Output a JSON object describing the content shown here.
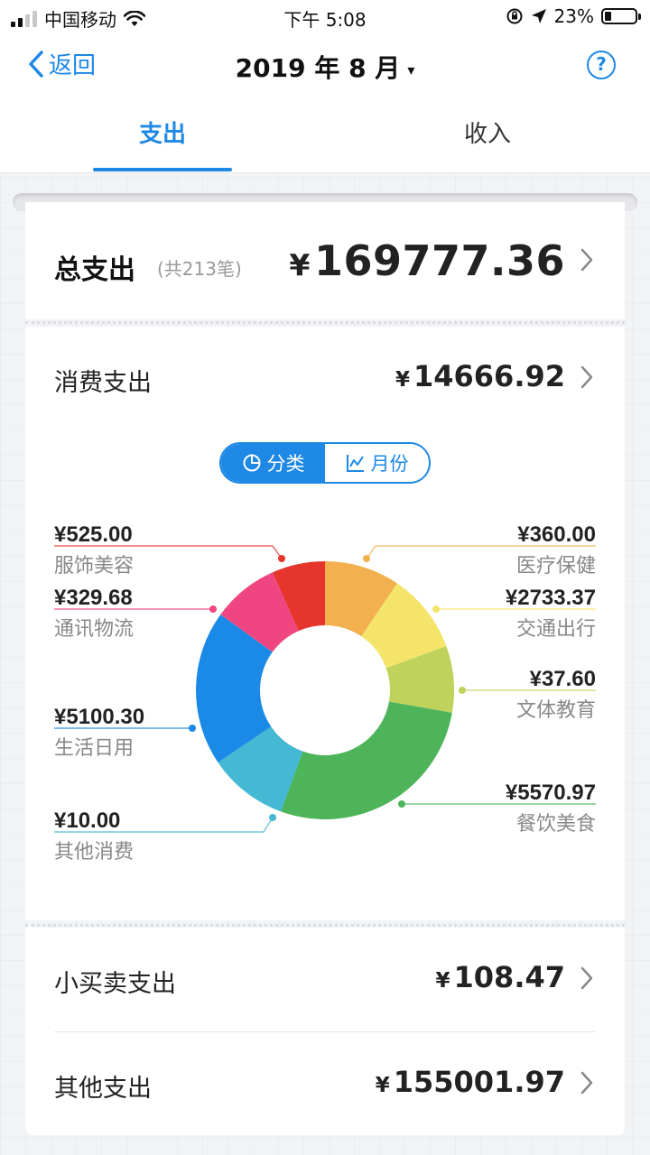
{
  "status_bar": {
    "carrier": "中国移动",
    "time": "下午 5:08",
    "battery": "23%"
  },
  "nav": {
    "back_label": "返回",
    "title": "2019 年 8 月",
    "caret": "▾",
    "help": "?"
  },
  "tabs": [
    {
      "label": "支出",
      "active": true
    },
    {
      "label": "收入",
      "active": false
    }
  ],
  "total": {
    "label": "总支出",
    "count": "(共213笔)",
    "currency": "¥",
    "amount": "169777.36"
  },
  "consume": {
    "label": "消费支出",
    "currency": "¥",
    "amount": "14666.92"
  },
  "toggle": {
    "category_label": "分类",
    "month_label": "月份"
  },
  "chart_data": {
    "type": "pie",
    "categories": [
      "医疗保健",
      "交通出行",
      "文体教育",
      "餐饮美食",
      "其他消费",
      "生活日用",
      "通讯物流",
      "服饰美容"
    ],
    "values": [
      360.0,
      2733.37,
      37.6,
      5570.97,
      10.0,
      5100.3,
      329.68,
      525.0
    ],
    "labels": [
      "¥360.00",
      "¥2733.37",
      "¥37.60",
      "¥5570.97",
      "¥10.00",
      "¥5100.30",
      "¥329.68",
      "¥525.00"
    ],
    "colors": [
      "#f2b14e",
      "#f4e56a",
      "#bfd35c",
      "#4db45a",
      "#45b8d4",
      "#1a8ae6",
      "#ef4681",
      "#e5352c"
    ],
    "slice_degrees": [
      34,
      36,
      30,
      100,
      36,
      70,
      30,
      24
    ]
  },
  "bottom": {
    "small_label": "小买卖支出",
    "small_amount": "108.47",
    "other_label": "其他支出",
    "other_amount": "155001.97",
    "currency": "¥"
  }
}
